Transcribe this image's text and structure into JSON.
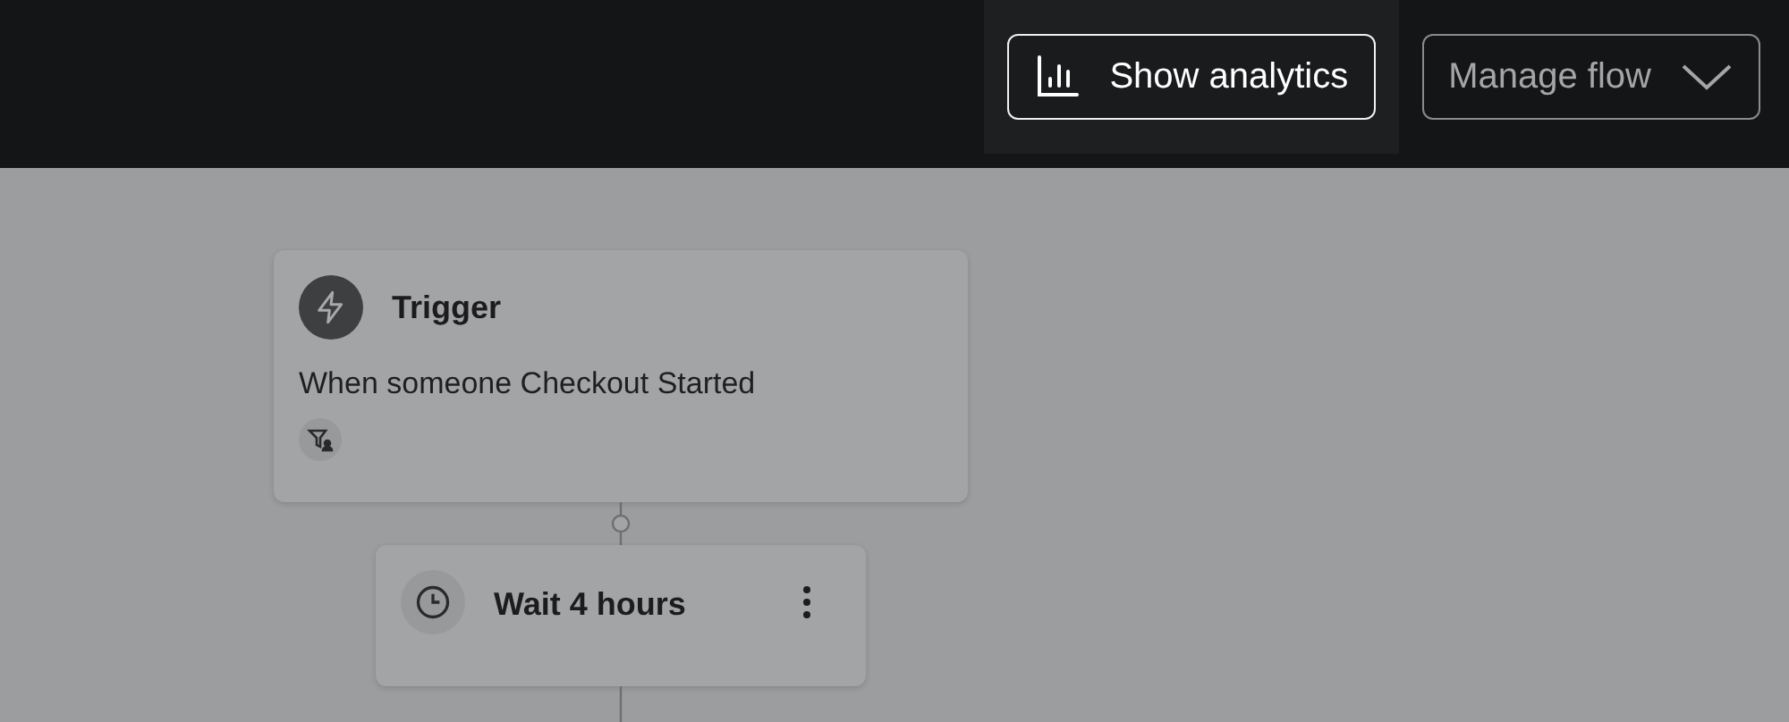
{
  "header": {
    "buttons": [
      {
        "label": "Show analytics",
        "kind": "analytics",
        "highlighted": true
      },
      {
        "label": "Manage flow",
        "kind": "dropdown",
        "highlighted": false
      }
    ]
  },
  "flow": {
    "nodes": [
      {
        "kind": "trigger",
        "title": "Trigger",
        "description": "When someone Checkout Started"
      },
      {
        "kind": "delay",
        "title": "Wait 4 hours"
      }
    ]
  }
}
